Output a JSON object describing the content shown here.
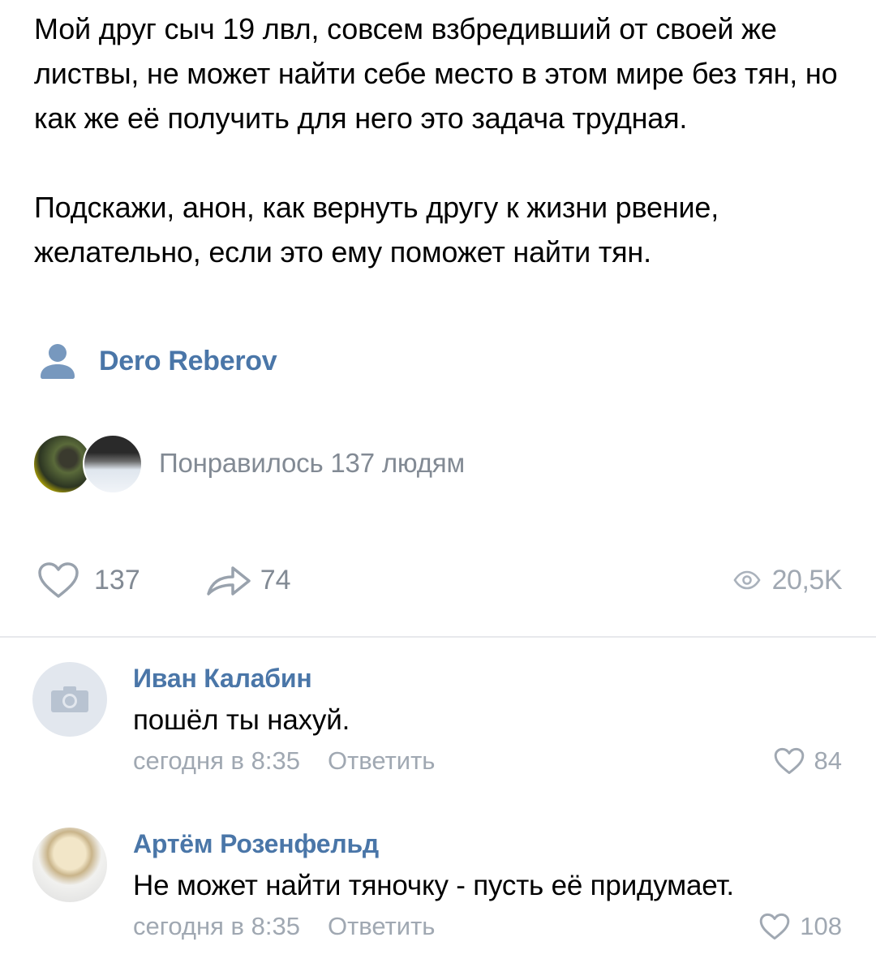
{
  "post": {
    "paragraphs": [
      "Мой друг сыч 19 лвл, совсем взбредивший от своей же листвы, не может найти себе место в этом мире без тян, но как же её получить для него это задача трудная.",
      "Подскажи, анон, как вернуть другу к жизни рвение, желательно, если это ему поможет найти тян."
    ],
    "author": "Dero Reberov",
    "likers_text": "Понравилось 137 людям",
    "likes": "137",
    "shares": "74",
    "views": "20,5K"
  },
  "comments": [
    {
      "name": "Иван Калабин",
      "text": "пошёл ты нахуй.",
      "time": "сегодня в 8:35",
      "reply": "Ответить",
      "likes": "84",
      "avatar": "camera-placeholder"
    },
    {
      "name": "Артём Розенфельд",
      "text": "Не может найти тяночку - пусть её придумает.",
      "time": "сегодня в 8:35",
      "reply": "Ответить",
      "likes": "108",
      "avatar": "photo"
    }
  ],
  "colors": {
    "link": "#4a76a8",
    "muted": "#828a94",
    "divider": "#e7e8ec"
  },
  "icons": [
    "person-icon",
    "heart-icon",
    "share-icon",
    "eye-icon",
    "camera-icon"
  ]
}
